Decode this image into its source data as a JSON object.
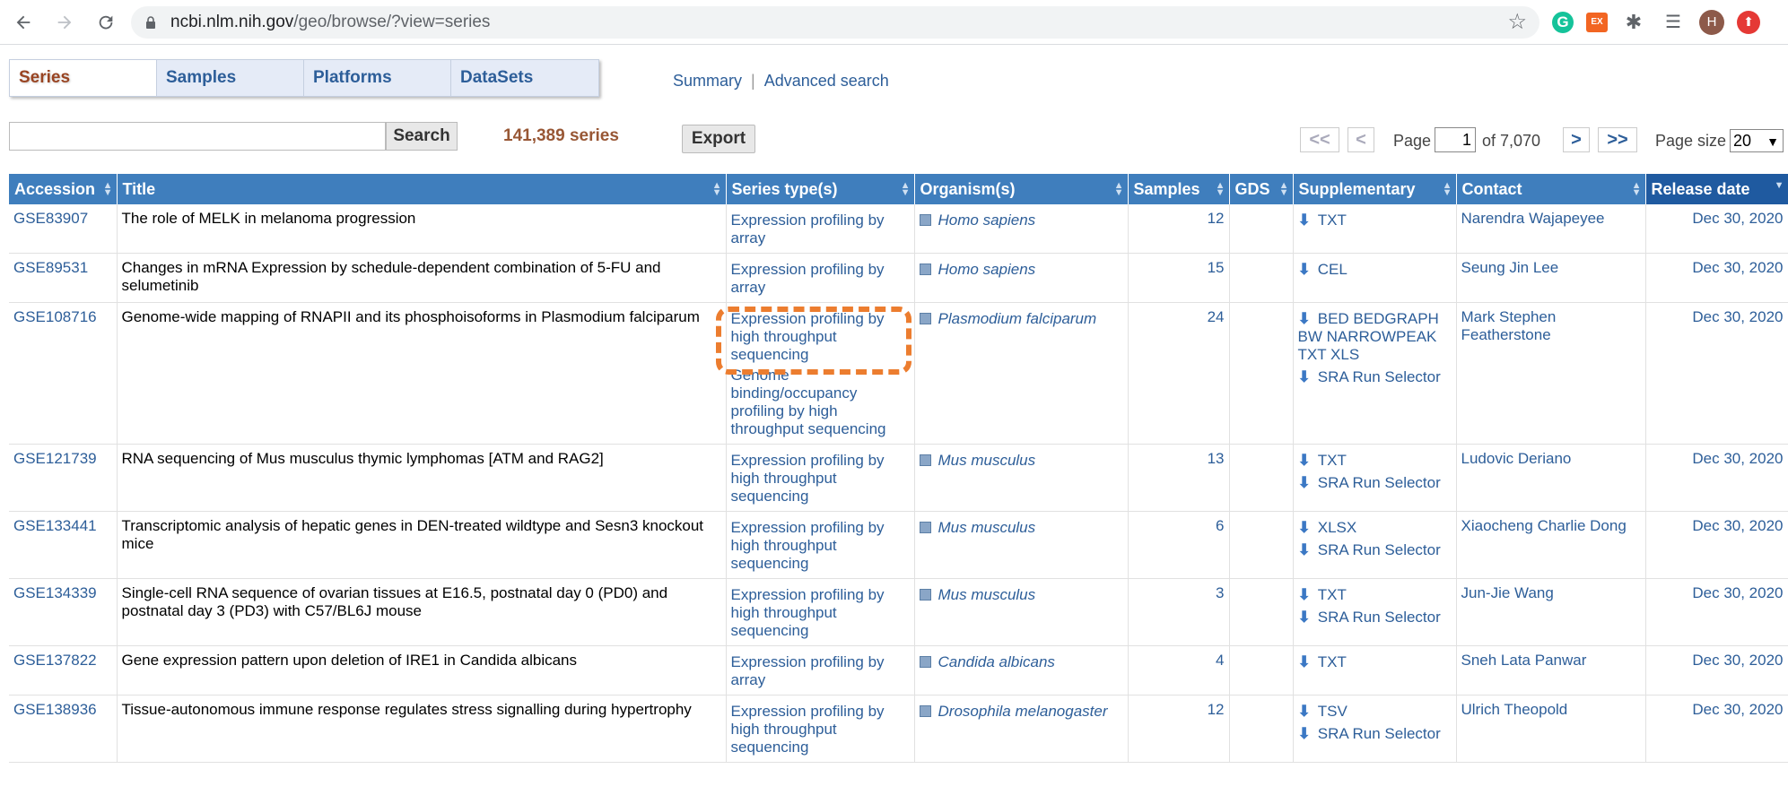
{
  "browser": {
    "url_host": "ncbi.nlm.nih.gov",
    "url_path": "/geo/browse/?view=series",
    "ext_g": "G",
    "ext_ex": "EX",
    "avatar": "H"
  },
  "tabs": [
    {
      "label": "Series"
    },
    {
      "label": "Samples"
    },
    {
      "label": "Platforms"
    },
    {
      "label": "DataSets"
    }
  ],
  "links": {
    "summary": "Summary",
    "separator": "|",
    "advanced": "Advanced search"
  },
  "search": {
    "button": "Search",
    "value": ""
  },
  "count": "141,389 series",
  "export": "Export",
  "pager": {
    "first": "<<",
    "prev": "<",
    "page_label": "Page",
    "page": "1",
    "of": "of 7,070",
    "next": ">",
    "last": ">>",
    "size_label": "Page size",
    "size": "20"
  },
  "columns": [
    "Accession",
    "Title",
    "Series type(s)",
    "Organism(s)",
    "Samples",
    "GDS",
    "Supplementary",
    "Contact",
    "Release date"
  ],
  "rows": [
    {
      "acc": "GSE83907",
      "title": "The role of MELK in melanoma progression",
      "types": [
        "Expression profiling by array"
      ],
      "org": "Homo sapiens",
      "samples": "12",
      "supp": [
        "TXT"
      ],
      "contact": "Narendra Wajapeyee",
      "date": "Dec 30, 2020"
    },
    {
      "acc": "GSE89531",
      "title": "Changes in mRNA Expression by schedule-dependent combination of 5-FU and selumetinib",
      "types": [
        "Expression profiling by array"
      ],
      "org": "Homo sapiens",
      "samples": "15",
      "supp": [
        "CEL"
      ],
      "contact": "Seung Jin Lee",
      "date": "Dec 30, 2020"
    },
    {
      "acc": "GSE108716",
      "title": "Genome-wide mapping of RNAPII and its phosphoisoforms in Plasmodium falciparum",
      "types": [
        "Expression profiling by high throughput sequencing",
        "Genome binding/occupancy profiling by high throughput sequencing"
      ],
      "org": "Plasmodium falciparum",
      "samples": "24",
      "supp": [
        "BED BEDGRAPH BW NARROWPEAK TXT XLS",
        "SRA Run Selector"
      ],
      "contact": "Mark Stephen Featherstone",
      "date": "Dec 30, 2020"
    },
    {
      "acc": "GSE121739",
      "title": "RNA sequencing of Mus musculus thymic lymphomas [ATM and RAG2]",
      "types": [
        "Expression profiling by high throughput sequencing"
      ],
      "org": "Mus musculus",
      "samples": "13",
      "supp": [
        "TXT",
        "SRA Run Selector"
      ],
      "contact": "Ludovic Deriano",
      "date": "Dec 30, 2020"
    },
    {
      "acc": "GSE133441",
      "title": "Transcriptomic analysis of hepatic genes in DEN-treated wildtype and Sesn3 knockout mice",
      "types": [
        "Expression profiling by high throughput sequencing"
      ],
      "org": "Mus musculus",
      "samples": "6",
      "supp": [
        "XLSX",
        "SRA Run Selector"
      ],
      "contact": "Xiaocheng Charlie Dong",
      "date": "Dec 30, 2020"
    },
    {
      "acc": "GSE134339",
      "title": "Single-cell RNA sequence of ovarian tissues at E16.5, postnatal day 0 (PD0) and postnatal day 3 (PD3) with C57/BL6J mouse",
      "types": [
        "Expression profiling by high throughput sequencing"
      ],
      "org": "Mus musculus",
      "samples": "3",
      "supp": [
        "TXT",
        "SRA Run Selector"
      ],
      "contact": "Jun-Jie Wang",
      "date": "Dec 30, 2020"
    },
    {
      "acc": "GSE137822",
      "title": "Gene expression pattern upon deletion of IRE1 in Candida albicans",
      "types": [
        "Expression profiling by array"
      ],
      "org": "Candida albicans",
      "samples": "4",
      "supp": [
        "TXT"
      ],
      "contact": "Sneh Lata Panwar",
      "date": "Dec 30, 2020"
    },
    {
      "acc": "GSE138936",
      "title": "Tissue-autonomous immune response regulates stress signalling during hypertrophy",
      "types": [
        "Expression profiling by high throughput sequencing"
      ],
      "org": "Drosophila melanogaster",
      "samples": "12",
      "supp": [
        "TSV",
        "SRA Run Selector"
      ],
      "contact": "Ulrich Theopold",
      "date": "Dec 30, 2020"
    }
  ]
}
